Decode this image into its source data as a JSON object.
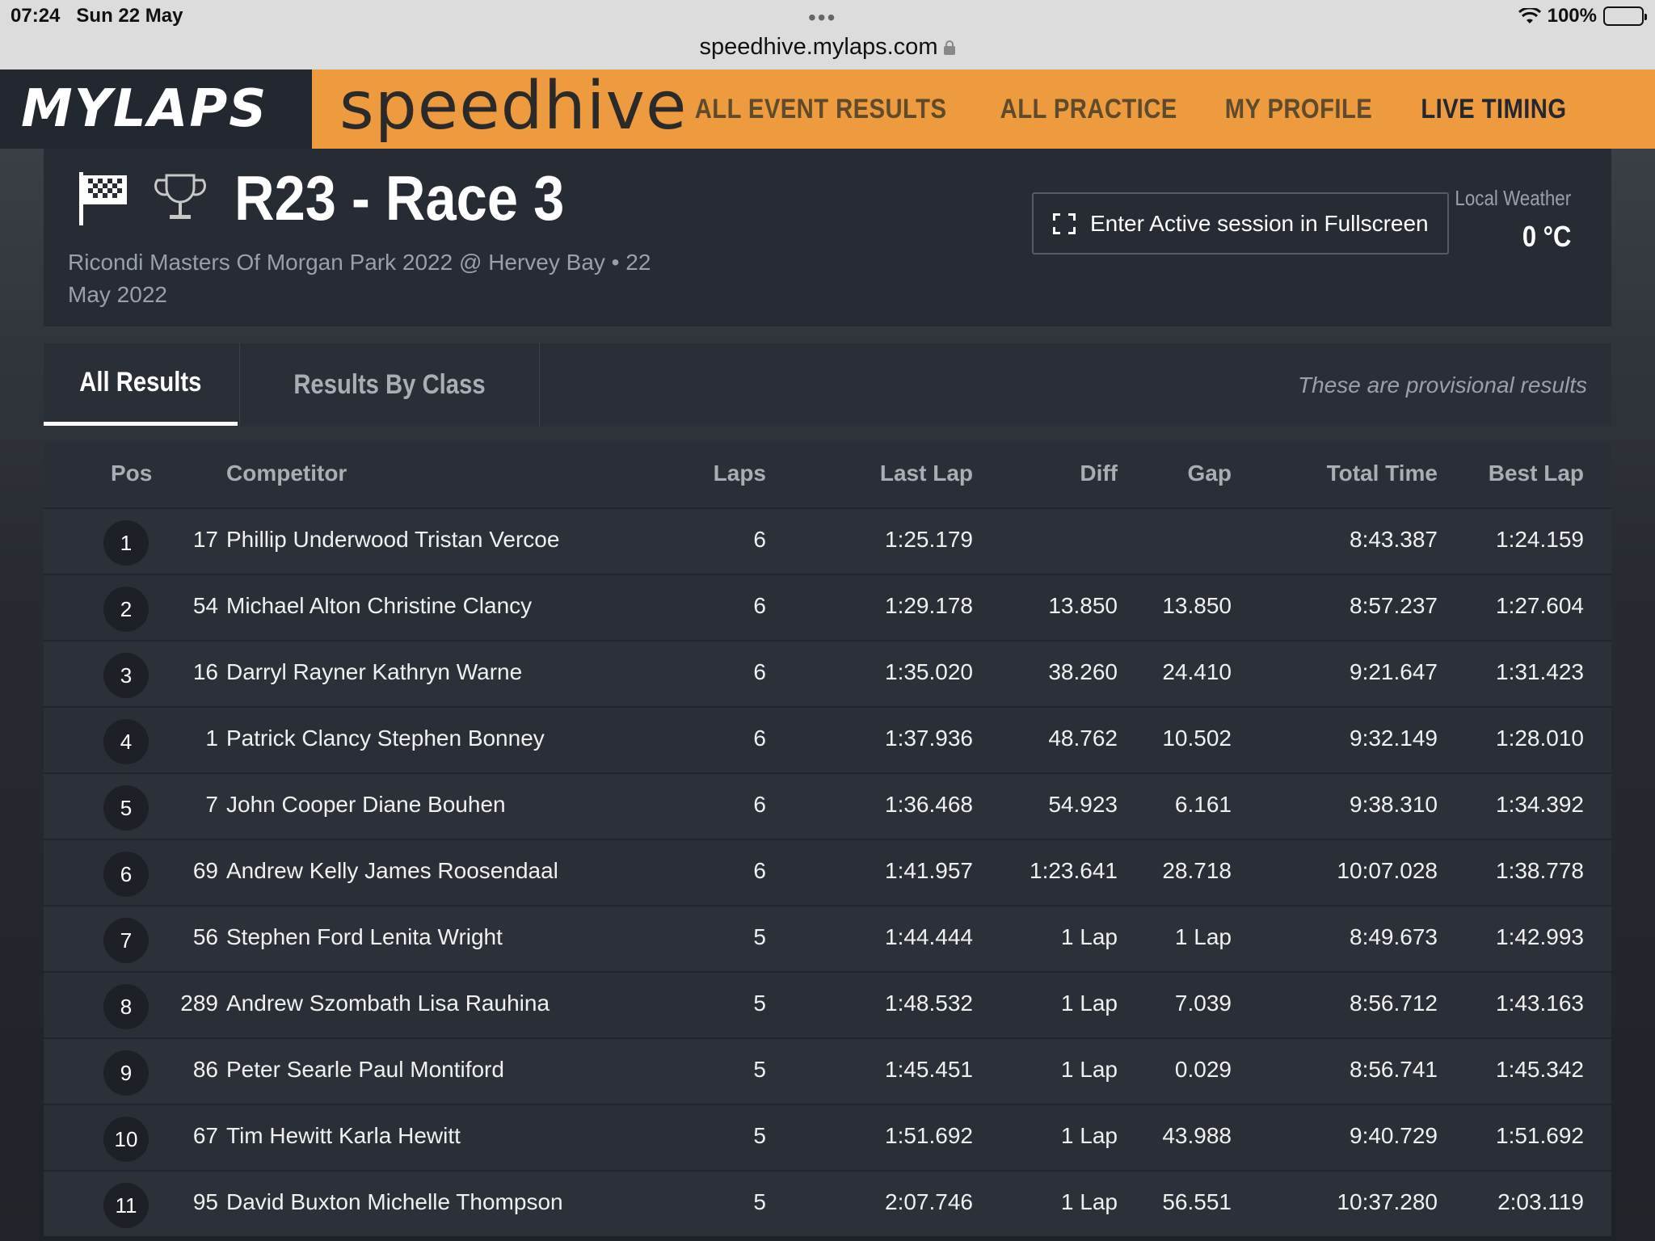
{
  "status_bar": {
    "time": "07:24",
    "date": "Sun 22 May",
    "battery": "100%"
  },
  "browser": {
    "url": "speedhive.mylaps.com",
    "menu_dots": "•••"
  },
  "header": {
    "brand": "MYLAPS",
    "product": "speedhive",
    "nav": [
      "ALL EVENT RESULTS",
      "ALL PRACTICE",
      "MY PROFILE",
      "LIVE TIMING"
    ],
    "active_nav": "LIVE TIMING",
    "accent_color": "#ee9a3e"
  },
  "session": {
    "title": "R23 - Race 3",
    "subtitle": "Ricondi Masters Of Morgan Park 2022 @ Hervey Bay • 22 May 2022",
    "fullscreen_label": "Enter Active session in Fullscreen",
    "weather_label": "Local Weather",
    "weather_value": "0 °C"
  },
  "tabs": {
    "all": "All Results",
    "by_class": "Results By Class",
    "note": "These are provisional results"
  },
  "table": {
    "headers": {
      "pos": "Pos",
      "competitor": "Competitor",
      "laps": "Laps",
      "last_lap": "Last Lap",
      "diff": "Diff",
      "gap": "Gap",
      "total": "Total Time",
      "best": "Best Lap"
    },
    "rows": [
      {
        "pos": "1",
        "num": "17",
        "name": "Phillip Underwood Tristan Vercoe",
        "laps": "6",
        "last": "1:25.179",
        "diff": "",
        "gap": "",
        "total": "8:43.387",
        "best": "1:24.159"
      },
      {
        "pos": "2",
        "num": "54",
        "name": "Michael Alton Christine Clancy",
        "laps": "6",
        "last": "1:29.178",
        "diff": "13.850",
        "gap": "13.850",
        "total": "8:57.237",
        "best": "1:27.604"
      },
      {
        "pos": "3",
        "num": "16",
        "name": "Darryl Rayner Kathryn Warne",
        "laps": "6",
        "last": "1:35.020",
        "diff": "38.260",
        "gap": "24.410",
        "total": "9:21.647",
        "best": "1:31.423"
      },
      {
        "pos": "4",
        "num": "1",
        "name": "Patrick Clancy Stephen Bonney",
        "laps": "6",
        "last": "1:37.936",
        "diff": "48.762",
        "gap": "10.502",
        "total": "9:32.149",
        "best": "1:28.010"
      },
      {
        "pos": "5",
        "num": "7",
        "name": "John Cooper Diane Bouhen",
        "laps": "6",
        "last": "1:36.468",
        "diff": "54.923",
        "gap": "6.161",
        "total": "9:38.310",
        "best": "1:34.392"
      },
      {
        "pos": "6",
        "num": "69",
        "name": "Andrew Kelly James Roosendaal",
        "laps": "6",
        "last": "1:41.957",
        "diff": "1:23.641",
        "gap": "28.718",
        "total": "10:07.028",
        "best": "1:38.778"
      },
      {
        "pos": "7",
        "num": "56",
        "name": "Stephen Ford Lenita Wright",
        "laps": "5",
        "last": "1:44.444",
        "diff": "1 Lap",
        "gap": "1 Lap",
        "total": "8:49.673",
        "best": "1:42.993"
      },
      {
        "pos": "8",
        "num": "289",
        "name": "Andrew Szombath Lisa Rauhina",
        "laps": "5",
        "last": "1:48.532",
        "diff": "1 Lap",
        "gap": "7.039",
        "total": "8:56.712",
        "best": "1:43.163"
      },
      {
        "pos": "9",
        "num": "86",
        "name": "Peter Searle Paul Montiford",
        "laps": "5",
        "last": "1:45.451",
        "diff": "1 Lap",
        "gap": "0.029",
        "total": "8:56.741",
        "best": "1:45.342"
      },
      {
        "pos": "10",
        "num": "67",
        "name": "Tim Hewitt Karla Hewitt",
        "laps": "5",
        "last": "1:51.692",
        "diff": "1 Lap",
        "gap": "43.988",
        "total": "9:40.729",
        "best": "1:51.692"
      },
      {
        "pos": "11",
        "num": "95",
        "name": "David Buxton Michelle Thompson",
        "laps": "5",
        "last": "2:07.746",
        "diff": "1 Lap",
        "gap": "56.551",
        "total": "10:37.280",
        "best": "2:03.119"
      }
    ]
  }
}
